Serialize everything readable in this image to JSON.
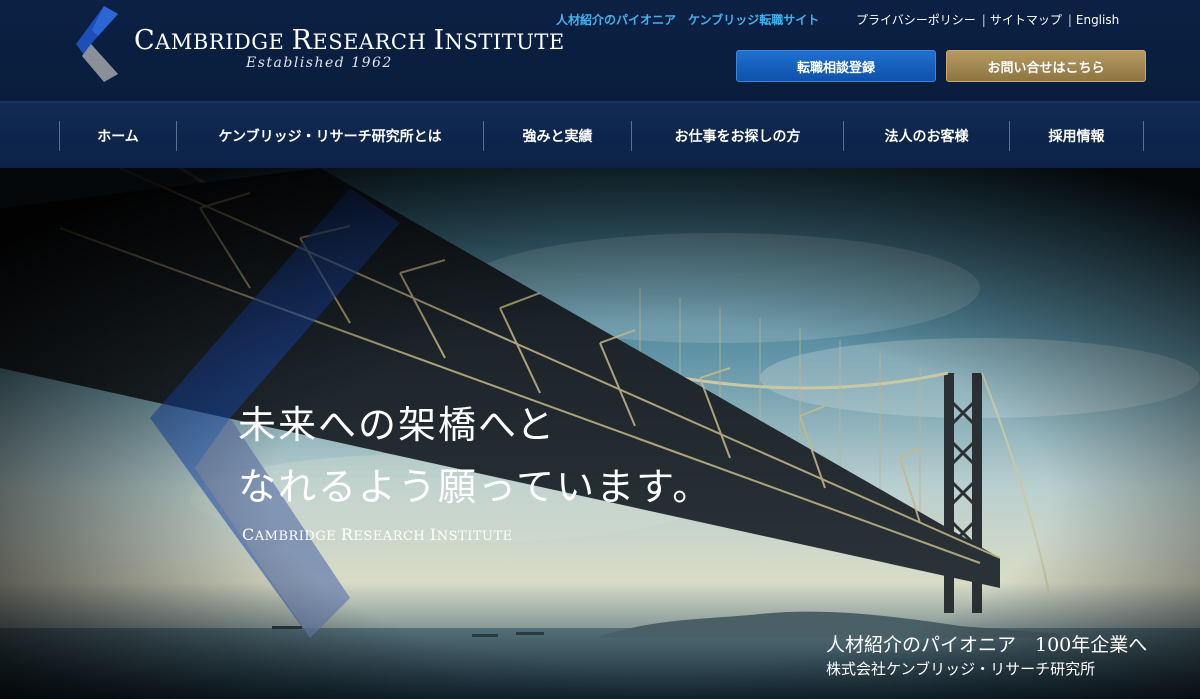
{
  "header": {
    "logo": {
      "name_words": [
        [
          "C",
          "AMBRIDGE"
        ],
        [
          "R",
          "ESEARCH"
        ],
        [
          "I",
          "NSTITUTE"
        ]
      ],
      "established": "Established 1962"
    },
    "site_link": "人材紹介のパイオニア　ケンブリッジ転職サイト",
    "links": [
      "プライバシーポリシー",
      "サイトマップ",
      "English"
    ],
    "buttons": {
      "consult": "転職相談登録",
      "contact": "お問い合せはこちら"
    }
  },
  "nav": {
    "items": [
      "ホーム",
      "ケンブリッジ・リサーチ研究所とは",
      "強みと実績",
      "お仕事をお探しの方",
      "法人のお客様",
      "採用情報"
    ]
  },
  "hero": {
    "title_line1": "未来への架橋へと",
    "title_line2": "なれるよう願っています。",
    "sub": [
      [
        "C",
        "AMBRIDGE"
      ],
      [
        "R",
        "ESEARCH"
      ],
      [
        "I",
        "NSTITUTE"
      ]
    ],
    "tagline": "人材紹介のパイオニア　100年企業へ",
    "company": "株式会社ケンブリッジ・リサーチ研究所"
  },
  "colors": {
    "header_bg": "#0b2043",
    "site_link": "#3fb4f0",
    "consult_btn": "#1f6fd0",
    "contact_btn": "#a88d56"
  },
  "icons": {
    "logo_mark": "chevron-logo-icon"
  }
}
